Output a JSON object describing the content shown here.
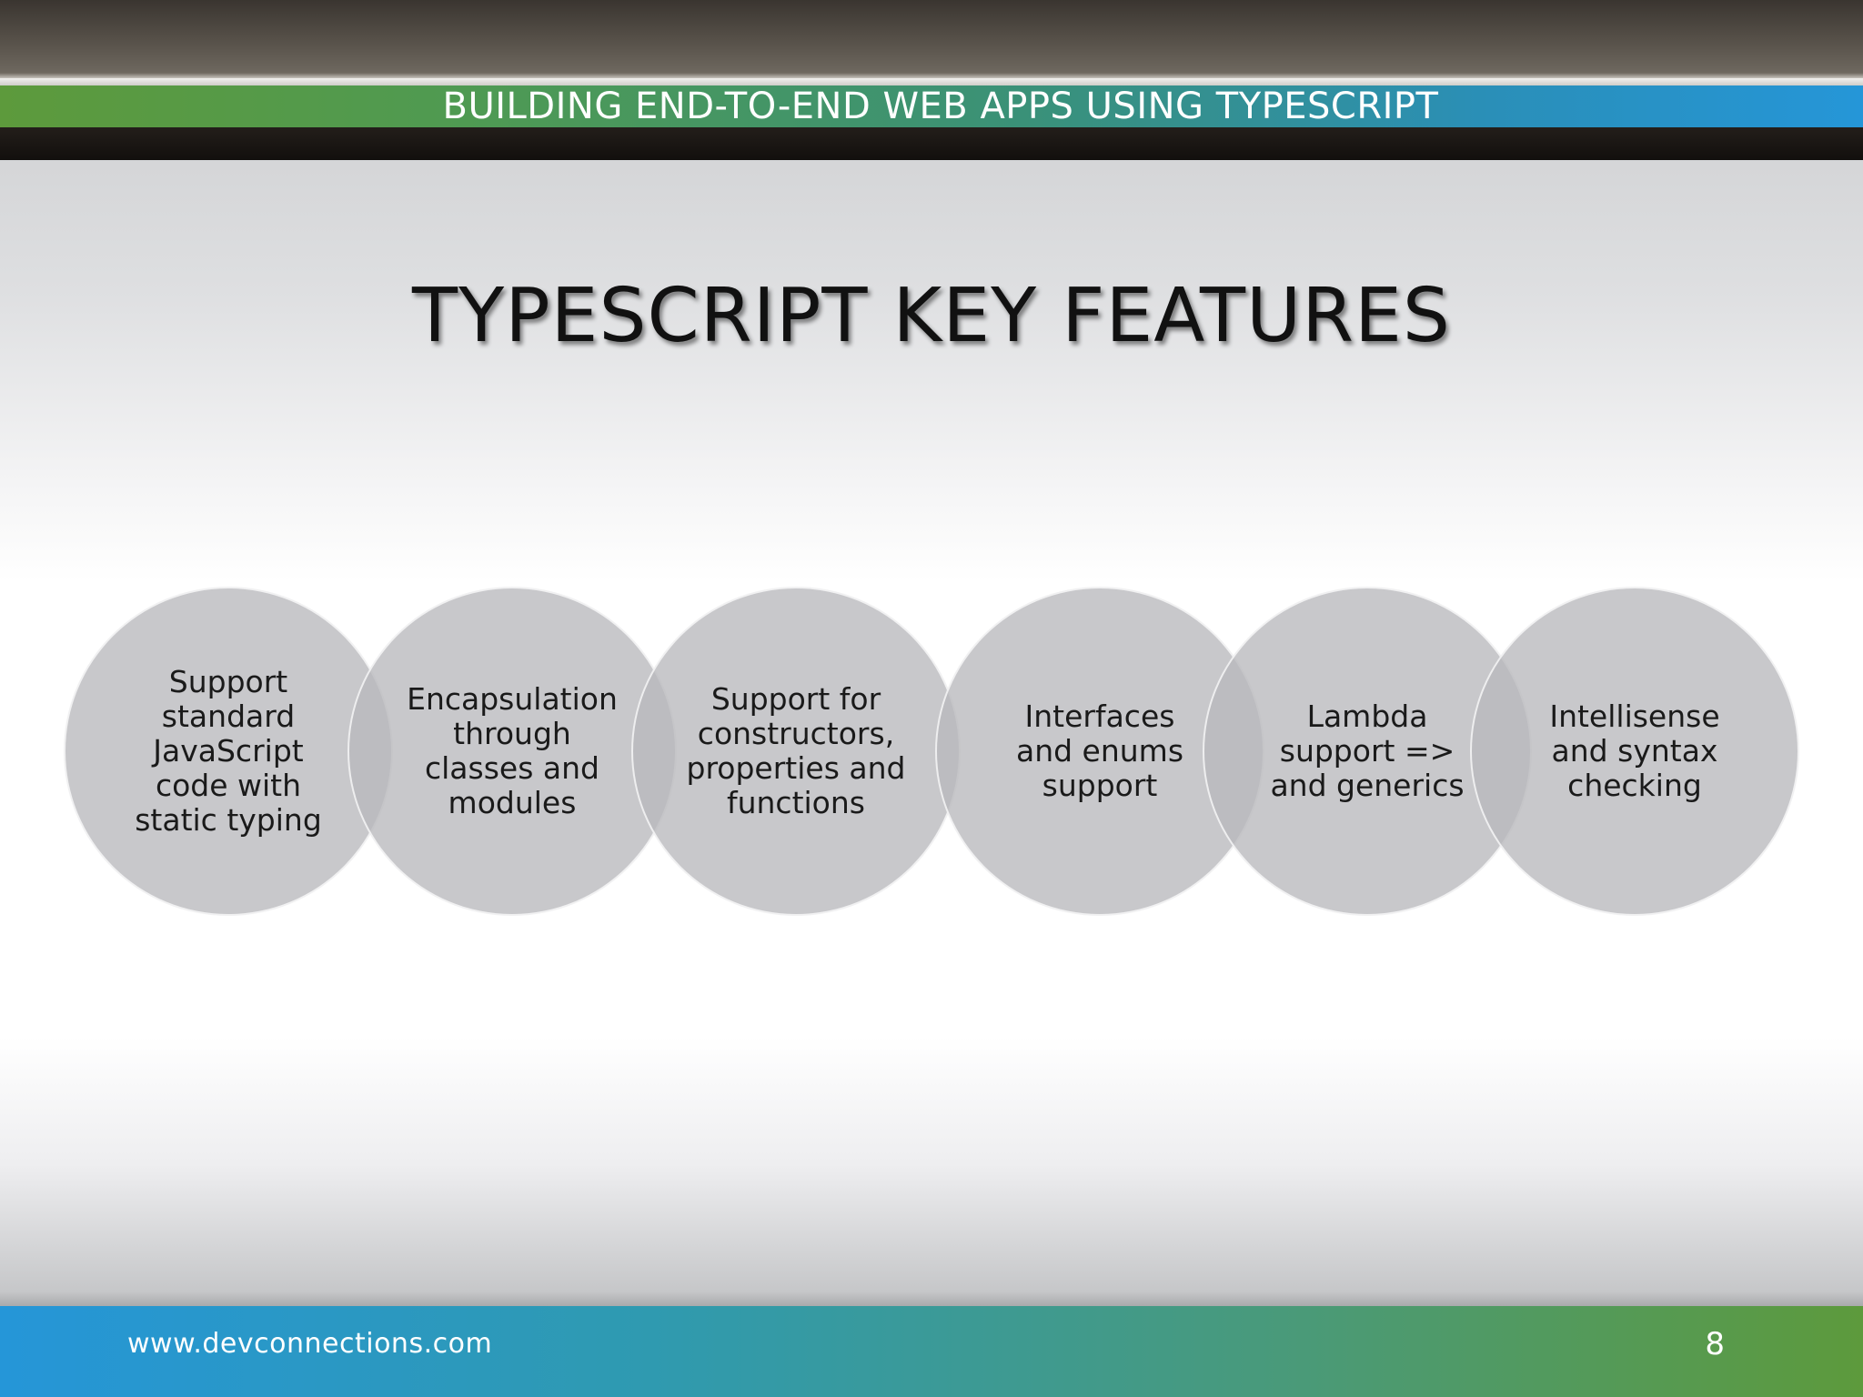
{
  "header": {
    "presentation_title": "BUILDING END-TO-END WEB APPS USING TYPESCRIPT"
  },
  "slide": {
    "title": "TYPESCRIPT KEY FEATURES",
    "features": [
      {
        "text": "Support\nstandard\nJavaScript\ncode with\nstatic typing"
      },
      {
        "text": "Encapsulation\nthrough\nclasses and\nmodules"
      },
      {
        "text": "Support for\nconstructors,\nproperties and\nfunctions"
      },
      {
        "text": "Interfaces\nand enums\nsupport"
      },
      {
        "text": "Lambda\nsupport =>\nand generics"
      },
      {
        "text": "Intellisense\nand syntax\nchecking"
      }
    ]
  },
  "footer": {
    "url": "www.devconnections.com",
    "page_number": "8"
  },
  "colors": {
    "accent_green": "#5d9a3c",
    "accent_blue": "#2596d8",
    "circle_gray": "#b9b8bc",
    "dark_band": "#1a1512"
  }
}
